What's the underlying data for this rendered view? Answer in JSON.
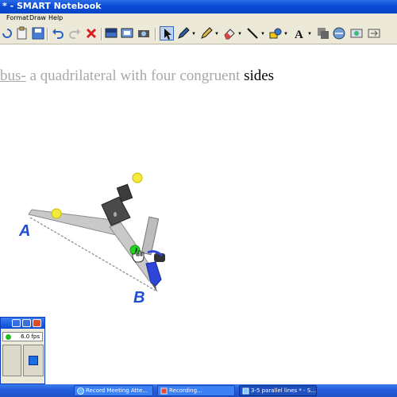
{
  "window": {
    "title": "* - SMART Notebook"
  },
  "menu": {
    "items": [
      "Format",
      "Draw",
      "Help"
    ]
  },
  "toolbar": {
    "buttons": [
      "undo-icon",
      "redo-icon",
      "delete-icon",
      "screen-shade-icon",
      "full-screen-icon",
      "camera-icon",
      "select-icon",
      "pen-icon",
      "creative-pen-icon",
      "eraser-icon",
      "line-icon",
      "shapes-icon",
      "text-icon",
      "fill-icon",
      "properties-icon",
      "capture-icon"
    ]
  },
  "page": {
    "heading_term": "bus-",
    "heading_rest": " a quadrilateral with four congruent ",
    "heading_last": "sides",
    "label_a": "A",
    "label_b": "B"
  },
  "recorder": {
    "fps": "6.0 fps"
  },
  "taskbar": {
    "tasks": [
      {
        "label": "Record Meeting Atte..."
      },
      {
        "label": "Recording..."
      },
      {
        "label": "3-5 parallel lines * - S..."
      }
    ]
  },
  "colors": {
    "accent": "#0a4bd6",
    "handwriting": "#1f4ed6",
    "heading_gray": "#a8a8a8"
  }
}
